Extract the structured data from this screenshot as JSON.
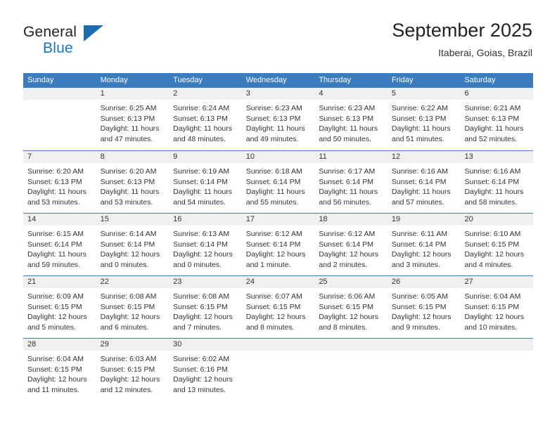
{
  "brand": {
    "name_part1": "General",
    "name_part2": "Blue",
    "logo_icon": "triangle-logo-icon"
  },
  "header": {
    "title": "September 2025",
    "subtitle": "Itaberai, Goias, Brazil"
  },
  "theme": {
    "header_blue": "#3a7cbe",
    "brand_blue": "#1b75bb",
    "day_number_bg": "#f0f0f0",
    "text": "#333333"
  },
  "weekdays": [
    "Sunday",
    "Monday",
    "Tuesday",
    "Wednesday",
    "Thursday",
    "Friday",
    "Saturday"
  ],
  "weeks": [
    [
      {
        "day": "",
        "lines": []
      },
      {
        "day": "1",
        "lines": [
          "Sunrise: 6:25 AM",
          "Sunset: 6:13 PM",
          "Daylight: 11 hours",
          "and 47 minutes."
        ]
      },
      {
        "day": "2",
        "lines": [
          "Sunrise: 6:24 AM",
          "Sunset: 6:13 PM",
          "Daylight: 11 hours",
          "and 48 minutes."
        ]
      },
      {
        "day": "3",
        "lines": [
          "Sunrise: 6:23 AM",
          "Sunset: 6:13 PM",
          "Daylight: 11 hours",
          "and 49 minutes."
        ]
      },
      {
        "day": "4",
        "lines": [
          "Sunrise: 6:23 AM",
          "Sunset: 6:13 PM",
          "Daylight: 11 hours",
          "and 50 minutes."
        ]
      },
      {
        "day": "5",
        "lines": [
          "Sunrise: 6:22 AM",
          "Sunset: 6:13 PM",
          "Daylight: 11 hours",
          "and 51 minutes."
        ]
      },
      {
        "day": "6",
        "lines": [
          "Sunrise: 6:21 AM",
          "Sunset: 6:13 PM",
          "Daylight: 11 hours",
          "and 52 minutes."
        ]
      }
    ],
    [
      {
        "day": "7",
        "lines": [
          "Sunrise: 6:20 AM",
          "Sunset: 6:13 PM",
          "Daylight: 11 hours",
          "and 53 minutes."
        ]
      },
      {
        "day": "8",
        "lines": [
          "Sunrise: 6:20 AM",
          "Sunset: 6:13 PM",
          "Daylight: 11 hours",
          "and 53 minutes."
        ]
      },
      {
        "day": "9",
        "lines": [
          "Sunrise: 6:19 AM",
          "Sunset: 6:14 PM",
          "Daylight: 11 hours",
          "and 54 minutes."
        ]
      },
      {
        "day": "10",
        "lines": [
          "Sunrise: 6:18 AM",
          "Sunset: 6:14 PM",
          "Daylight: 11 hours",
          "and 55 minutes."
        ]
      },
      {
        "day": "11",
        "lines": [
          "Sunrise: 6:17 AM",
          "Sunset: 6:14 PM",
          "Daylight: 11 hours",
          "and 56 minutes."
        ]
      },
      {
        "day": "12",
        "lines": [
          "Sunrise: 6:16 AM",
          "Sunset: 6:14 PM",
          "Daylight: 11 hours",
          "and 57 minutes."
        ]
      },
      {
        "day": "13",
        "lines": [
          "Sunrise: 6:16 AM",
          "Sunset: 6:14 PM",
          "Daylight: 11 hours",
          "and 58 minutes."
        ]
      }
    ],
    [
      {
        "day": "14",
        "lines": [
          "Sunrise: 6:15 AM",
          "Sunset: 6:14 PM",
          "Daylight: 11 hours",
          "and 59 minutes."
        ]
      },
      {
        "day": "15",
        "lines": [
          "Sunrise: 6:14 AM",
          "Sunset: 6:14 PM",
          "Daylight: 12 hours",
          "and 0 minutes."
        ]
      },
      {
        "day": "16",
        "lines": [
          "Sunrise: 6:13 AM",
          "Sunset: 6:14 PM",
          "Daylight: 12 hours",
          "and 0 minutes."
        ]
      },
      {
        "day": "17",
        "lines": [
          "Sunrise: 6:12 AM",
          "Sunset: 6:14 PM",
          "Daylight: 12 hours",
          "and 1 minute."
        ]
      },
      {
        "day": "18",
        "lines": [
          "Sunrise: 6:12 AM",
          "Sunset: 6:14 PM",
          "Daylight: 12 hours",
          "and 2 minutes."
        ]
      },
      {
        "day": "19",
        "lines": [
          "Sunrise: 6:11 AM",
          "Sunset: 6:14 PM",
          "Daylight: 12 hours",
          "and 3 minutes."
        ]
      },
      {
        "day": "20",
        "lines": [
          "Sunrise: 6:10 AM",
          "Sunset: 6:15 PM",
          "Daylight: 12 hours",
          "and 4 minutes."
        ]
      }
    ],
    [
      {
        "day": "21",
        "lines": [
          "Sunrise: 6:09 AM",
          "Sunset: 6:15 PM",
          "Daylight: 12 hours",
          "and 5 minutes."
        ]
      },
      {
        "day": "22",
        "lines": [
          "Sunrise: 6:08 AM",
          "Sunset: 6:15 PM",
          "Daylight: 12 hours",
          "and 6 minutes."
        ]
      },
      {
        "day": "23",
        "lines": [
          "Sunrise: 6:08 AM",
          "Sunset: 6:15 PM",
          "Daylight: 12 hours",
          "and 7 minutes."
        ]
      },
      {
        "day": "24",
        "lines": [
          "Sunrise: 6:07 AM",
          "Sunset: 6:15 PM",
          "Daylight: 12 hours",
          "and 8 minutes."
        ]
      },
      {
        "day": "25",
        "lines": [
          "Sunrise: 6:06 AM",
          "Sunset: 6:15 PM",
          "Daylight: 12 hours",
          "and 8 minutes."
        ]
      },
      {
        "day": "26",
        "lines": [
          "Sunrise: 6:05 AM",
          "Sunset: 6:15 PM",
          "Daylight: 12 hours",
          "and 9 minutes."
        ]
      },
      {
        "day": "27",
        "lines": [
          "Sunrise: 6:04 AM",
          "Sunset: 6:15 PM",
          "Daylight: 12 hours",
          "and 10 minutes."
        ]
      }
    ],
    [
      {
        "day": "28",
        "lines": [
          "Sunrise: 6:04 AM",
          "Sunset: 6:15 PM",
          "Daylight: 12 hours",
          "and 11 minutes."
        ]
      },
      {
        "day": "29",
        "lines": [
          "Sunrise: 6:03 AM",
          "Sunset: 6:15 PM",
          "Daylight: 12 hours",
          "and 12 minutes."
        ]
      },
      {
        "day": "30",
        "lines": [
          "Sunrise: 6:02 AM",
          "Sunset: 6:16 PM",
          "Daylight: 12 hours",
          "and 13 minutes."
        ]
      },
      {
        "day": "",
        "lines": []
      },
      {
        "day": "",
        "lines": []
      },
      {
        "day": "",
        "lines": []
      },
      {
        "day": "",
        "lines": []
      }
    ]
  ]
}
